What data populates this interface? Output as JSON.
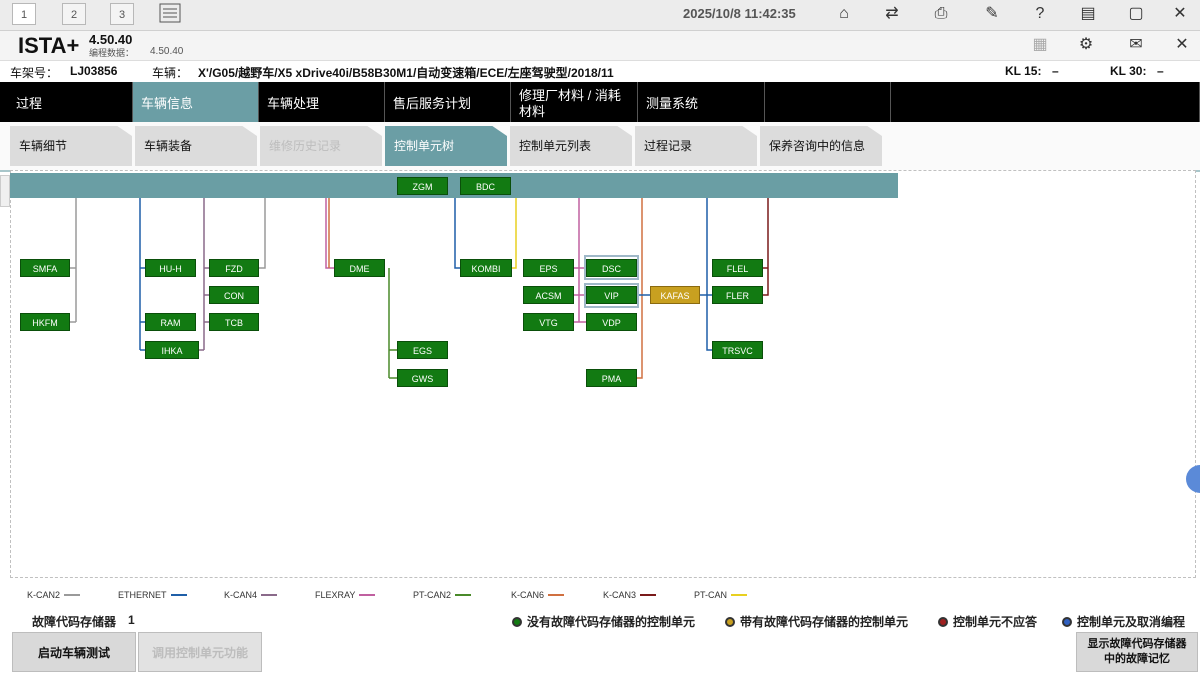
{
  "topbar": {
    "page_buttons": [
      "1",
      "2",
      "3"
    ],
    "datetime": "2025/10/8 11:42:35",
    "icons": [
      "home-icon",
      "vehicle-exchange-icon",
      "printer-icon",
      "wrench-icon",
      "help-icon",
      "dropdown-window-icon",
      "window-icon",
      "close-icon"
    ]
  },
  "title": {
    "app_name": "ISTA+",
    "version": "4.50.40",
    "program_data_label": "编程数据：",
    "program_data_version": "4.50.40",
    "icons": [
      "document-icon",
      "gear-icon",
      "mail-icon",
      "close-icon"
    ]
  },
  "vehicle": {
    "vin_label": "车架号：",
    "vin_value": "LJ03856",
    "vehicle_label": "车辆：",
    "vehicle_value": "X'/G05/越野车/X5 xDrive40i/B58B30M1/自动变速箱/ECE/左座驾驶型/2018/11",
    "kl15_label": "KL 15:",
    "kl15_value": "–",
    "kl30_label": "KL 30:",
    "kl30_value": "–"
  },
  "main_tabs": [
    "过程",
    "车辆信息",
    "车辆处理",
    "售后服务计划",
    "修理厂材料 / 消耗材料",
    "测量系统",
    "",
    ""
  ],
  "main_tab_active": 1,
  "sub_tabs": [
    "车辆细节",
    "车辆装备",
    "维修历史记录",
    "控制单元树",
    "控制单元列表",
    "过程记录",
    "保养咨询中的信息"
  ],
  "sub_tab_active": 3,
  "sub_tab_disabled": 2,
  "ecus": {
    "zgm": "ZGM",
    "bdc": "BDC",
    "smfa": "SMFA",
    "hkfm": "HKFM",
    "huh": "HU-H",
    "ram": "RAM",
    "ihka": "IHKA",
    "fzd": "FZD",
    "con": "CON",
    "tcb": "TCB",
    "dme": "DME",
    "egs": "EGS",
    "gws": "GWS",
    "kombi": "KOMBI",
    "eps": "EPS",
    "acsm": "ACSM",
    "vtg": "VTG",
    "dsc": "DSC",
    "vip": "VIP",
    "vdp": "VDP",
    "pma": "PMA",
    "kafas": "KAFAS",
    "flel": "FLEL",
    "fler": "FLER",
    "trsvc": "TRSVC"
  },
  "legend": [
    {
      "name": "K-CAN2",
      "color": "#9a9a9a"
    },
    {
      "name": "ETHERNET",
      "color": "#1f5fa8"
    },
    {
      "name": "K-CAN4",
      "color": "#8a6a8a"
    },
    {
      "name": "FLEXRAY",
      "color": "#c060a0"
    },
    {
      "name": "PT-CAN2",
      "color": "#4a8a2a"
    },
    {
      "name": "K-CAN6",
      "color": "#d07040"
    },
    {
      "name": "K-CAN3",
      "color": "#7a1a1a"
    },
    {
      "name": "PT-CAN",
      "color": "#e8d020"
    }
  ],
  "fault_memory": {
    "label": "故障代码存储器",
    "value": "1"
  },
  "status_legend": [
    {
      "label": "没有故障代码存储器的控制单元",
      "color": "#127a12"
    },
    {
      "label": "带有故障代码存储器的控制单元",
      "color": "#c8a020"
    },
    {
      "label": "控制单元不应答",
      "color": "#a02020"
    },
    {
      "label": "控制单元及取消编程",
      "color": "#3060c0"
    }
  ],
  "buttons": {
    "start_test": "启动车辆测试",
    "disabled_btn": "调用控制单元功能",
    "show_faults": "显示故障代码存储器中的故障记忆"
  }
}
